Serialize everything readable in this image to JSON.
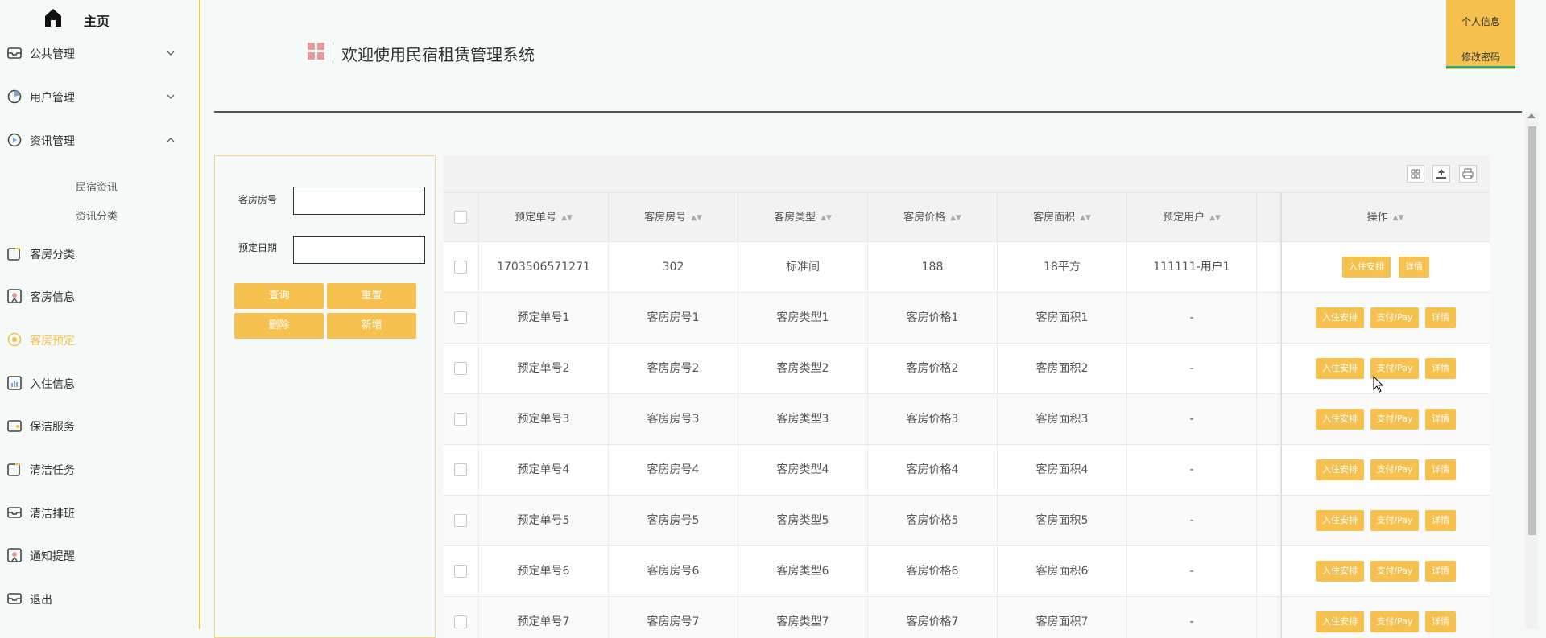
{
  "sidebar": {
    "home_label": "主页",
    "items": [
      {
        "label": "公共管理",
        "icon": "drawer-icon",
        "chevron": "down"
      },
      {
        "label": "用户管理",
        "icon": "user-pie-icon",
        "chevron": "down"
      },
      {
        "label": "资讯管理",
        "icon": "play-circle-icon",
        "chevron": "up"
      },
      {
        "label": "客房分类",
        "icon": "edit-icon"
      },
      {
        "label": "客房信息",
        "icon": "badge-icon"
      },
      {
        "label": "客房预定",
        "icon": "circle-icon",
        "active": true
      },
      {
        "label": "入住信息",
        "icon": "chart-icon"
      },
      {
        "label": "保洁服务",
        "icon": "wallet-icon"
      },
      {
        "label": "清洁任务",
        "icon": "edit-icon"
      },
      {
        "label": "清洁排班",
        "icon": "drawer-icon"
      },
      {
        "label": "通知提醒",
        "icon": "badge-icon"
      },
      {
        "label": "退出",
        "icon": "drawer-icon"
      }
    ],
    "sub_items": [
      "民宿资讯",
      "资讯分类"
    ]
  },
  "header": {
    "title": "欢迎使用民宿租赁管理系统",
    "profile_label": "个人信息",
    "change_password_label": "修改密码"
  },
  "search": {
    "room_no_label": "客房房号",
    "date_label": "预定日期",
    "buttons": {
      "query": "查询",
      "reset": "重置",
      "delete": "删除",
      "add": "新增"
    }
  },
  "table": {
    "columns": [
      "预定单号",
      "客房房号",
      "客房类型",
      "客房价格",
      "客房面积",
      "预定用户",
      "操作"
    ],
    "rows": [
      {
        "order": "1703506571271",
        "room": "302",
        "type": "标准间",
        "price": "188",
        "area": "18平方",
        "user": "111111-用户1",
        "actions": [
          "入住安排",
          "详情"
        ]
      },
      {
        "order": "预定单号1",
        "room": "客房房号1",
        "type": "客房类型1",
        "price": "客房价格1",
        "area": "客房面积1",
        "user": "-",
        "actions": [
          "入住安排",
          "支付/Pay",
          "详情"
        ]
      },
      {
        "order": "预定单号2",
        "room": "客房房号2",
        "type": "客房类型2",
        "price": "客房价格2",
        "area": "客房面积2",
        "user": "-",
        "actions": [
          "入住安排",
          "支付/Pay",
          "详情"
        ]
      },
      {
        "order": "预定单号3",
        "room": "客房房号3",
        "type": "客房类型3",
        "price": "客房价格3",
        "area": "客房面积3",
        "user": "-",
        "actions": [
          "入住安排",
          "支付/Pay",
          "详情"
        ]
      },
      {
        "order": "预定单号4",
        "room": "客房房号4",
        "type": "客房类型4",
        "price": "客房价格4",
        "area": "客房面积4",
        "user": "-",
        "actions": [
          "入住安排",
          "支付/Pay",
          "详情"
        ]
      },
      {
        "order": "预定单号5",
        "room": "客房房号5",
        "type": "客房类型5",
        "price": "客房价格5",
        "area": "客房面积5",
        "user": "-",
        "actions": [
          "入住安排",
          "支付/Pay",
          "详情"
        ]
      },
      {
        "order": "预定单号6",
        "room": "客房房号6",
        "type": "客房类型6",
        "price": "客房价格6",
        "area": "客房面积6",
        "user": "-",
        "actions": [
          "入住安排",
          "支付/Pay",
          "详情"
        ]
      },
      {
        "order": "预定单号7",
        "room": "客房房号7",
        "type": "客房类型7",
        "price": "客房价格7",
        "area": "客房面积7",
        "user": "-",
        "actions": [
          "入住安排",
          "支付/Pay",
          "详情"
        ]
      }
    ]
  },
  "colors": {
    "accent": "#f6c14f",
    "active_underline": "#2aa876"
  }
}
